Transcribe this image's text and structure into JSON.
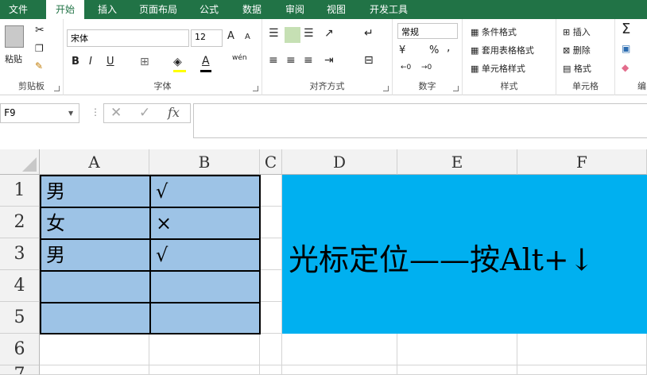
{
  "tabs": [
    "文件",
    "开始",
    "插入",
    "页面布局",
    "公式",
    "数据",
    "审阅",
    "视图",
    "开发工具"
  ],
  "ribbon": {
    "clipboard": {
      "paste": "粘贴",
      "label": "剪贴板"
    },
    "font": {
      "name": "宋体",
      "size": "12",
      "label": "字体",
      "bold": "B",
      "italic": "I",
      "underline": "U",
      "grow": "A",
      "shrink": "A",
      "wen": "wén"
    },
    "align": {
      "label": "对齐方式"
    },
    "number": {
      "format": "常规",
      "percent": "%",
      "comma": ",",
      "label": "数字"
    },
    "styles": {
      "cond": "条件格式",
      "table": "套用表格格式",
      "cell": "单元格样式",
      "label": "样式"
    },
    "cells": {
      "insert": "插入",
      "delete": "删除",
      "format": "格式",
      "label": "单元格"
    },
    "edit": {
      "label": "编"
    }
  },
  "formula_bar": {
    "name_box": "F9",
    "cancel": "✕",
    "enter": "✓",
    "fx": "fx",
    "value": ""
  },
  "grid": {
    "columns": [
      "A",
      "B",
      "C",
      "D",
      "E",
      "F"
    ],
    "rows": [
      "1",
      "2",
      "3",
      "4",
      "5",
      "6",
      "7"
    ],
    "cells": {
      "A1": "男",
      "B1": "√",
      "A2": "女",
      "B2": "×",
      "A3": "男",
      "B3": "√"
    },
    "merged_text": "光标定位——按Alt+↓",
    "highlight_fill": "#9dc3e6",
    "merged_fill": "#00b0f0"
  },
  "colors": {
    "accent": "#217346"
  }
}
